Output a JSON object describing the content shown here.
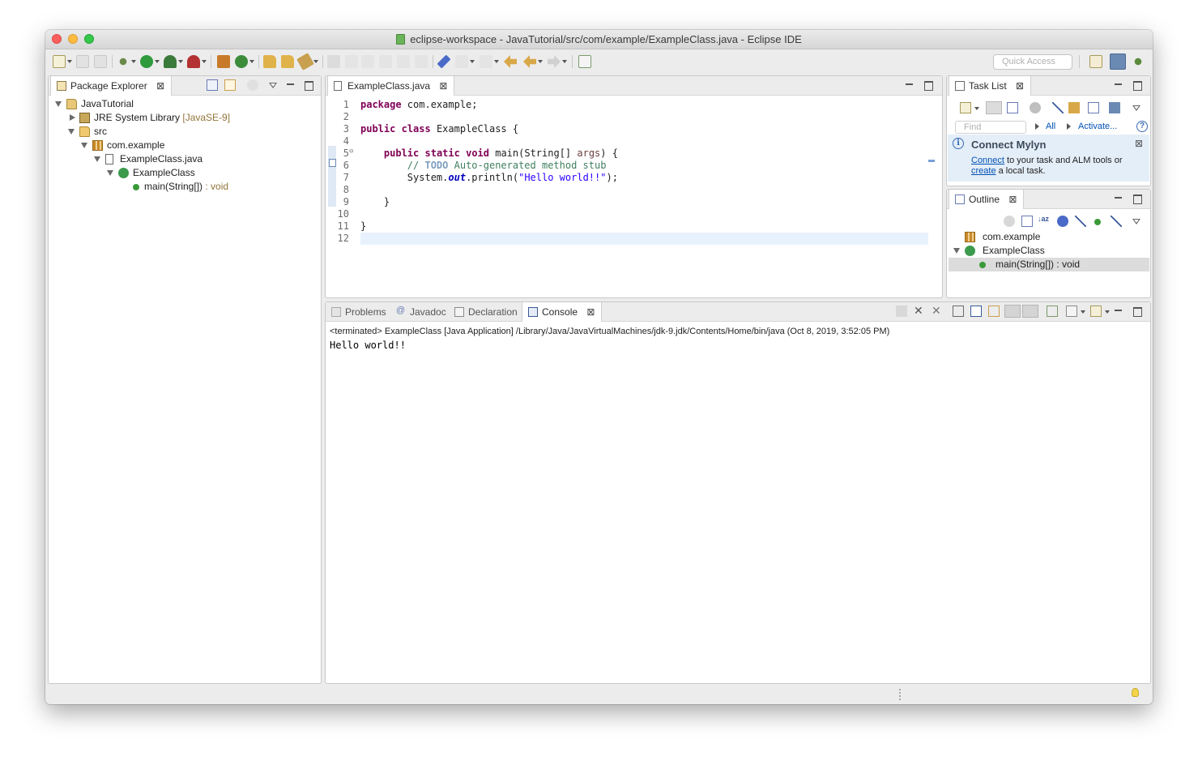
{
  "window": {
    "title": "eclipse-workspace - JavaTutorial/src/com/example/ExampleClass.java - Eclipse IDE"
  },
  "toolbar": {
    "quick_access_placeholder": "Quick Access"
  },
  "package_explorer": {
    "tab_label": "Package Explorer",
    "tree": {
      "project": "JavaTutorial",
      "jre": {
        "label": "JRE System Library",
        "decoration": "[JavaSE-9]"
      },
      "src": "src",
      "package": "com.example",
      "file": "ExampleClass.java",
      "class": "ExampleClass",
      "method": {
        "label": "main(String[])",
        "decoration": ": void"
      }
    }
  },
  "editor": {
    "tab_label": "ExampleClass.java",
    "lines": [
      {
        "num": "1",
        "tokens": [
          {
            "t": "package",
            "c": "kw"
          },
          {
            "t": " com.example;",
            "c": ""
          }
        ]
      },
      {
        "num": "2",
        "tokens": []
      },
      {
        "num": "3",
        "tokens": [
          {
            "t": "public",
            "c": "kw"
          },
          {
            "t": " ",
            "c": ""
          },
          {
            "t": "class",
            "c": "kw"
          },
          {
            "t": " ExampleClass {",
            "c": ""
          }
        ]
      },
      {
        "num": "4",
        "tokens": []
      },
      {
        "num": "5",
        "tokens": [
          {
            "t": "    ",
            "c": ""
          },
          {
            "t": "public",
            "c": "kw"
          },
          {
            "t": " ",
            "c": ""
          },
          {
            "t": "static",
            "c": "kw"
          },
          {
            "t": " ",
            "c": ""
          },
          {
            "t": "void",
            "c": "kw"
          },
          {
            "t": " main(String[] ",
            "c": ""
          },
          {
            "t": "args",
            "c": "par"
          },
          {
            "t": ") {",
            "c": ""
          }
        ]
      },
      {
        "num": "6",
        "tokens": [
          {
            "t": "        // ",
            "c": "cm"
          },
          {
            "t": "TODO",
            "c": "todo"
          },
          {
            "t": " Auto-generated method stub",
            "c": "cm"
          }
        ]
      },
      {
        "num": "7",
        "tokens": [
          {
            "t": "        System.",
            "c": ""
          },
          {
            "t": "out",
            "c": "fld"
          },
          {
            "t": ".println(",
            "c": ""
          },
          {
            "t": "\"Hello world!!\"",
            "c": "st"
          },
          {
            "t": ");",
            "c": ""
          }
        ]
      },
      {
        "num": "8",
        "tokens": []
      },
      {
        "num": "9",
        "tokens": [
          {
            "t": "    }",
            "c": ""
          }
        ]
      },
      {
        "num": "10",
        "tokens": []
      },
      {
        "num": "11",
        "tokens": [
          {
            "t": "}",
            "c": ""
          }
        ]
      },
      {
        "num": "12",
        "tokens": []
      }
    ]
  },
  "task_list": {
    "tab_label": "Task List",
    "find_placeholder": "Find",
    "all_label": "All",
    "activate_label": "Activate...",
    "mylyn": {
      "title": "Connect Mylyn",
      "link_connect": "Connect",
      "text_middle": " to your task and ALM tools or",
      "link_create": "create",
      "text_end": " a local task."
    }
  },
  "outline": {
    "tab_label": "Outline",
    "package": "com.example",
    "class": "ExampleClass",
    "method": "main(String[]) : void"
  },
  "bottom": {
    "tabs": {
      "problems": "Problems",
      "javadoc": "Javadoc",
      "declaration": "Declaration",
      "console": "Console"
    },
    "console_header": "<terminated> ExampleClass [Java Application] /Library/Java/JavaVirtualMachines/jdk-9.jdk/Contents/Home/bin/java (Oct 8, 2019, 3:52:05 PM)",
    "console_output": "Hello world!!"
  },
  "icons": {
    "package_explorer": "package-explorer-icon",
    "java_file": "java-file-icon",
    "task_list": "task-list-icon",
    "outline": "outline-icon",
    "console": "console-icon",
    "info": "info-icon",
    "help": "help-icon",
    "tip": "lightbulb-icon"
  },
  "colors": {
    "keyword": "#7f0055",
    "comment": "#3f7f5f",
    "string": "#2a00ff",
    "field": "#0000c0",
    "link": "#0050b4"
  }
}
